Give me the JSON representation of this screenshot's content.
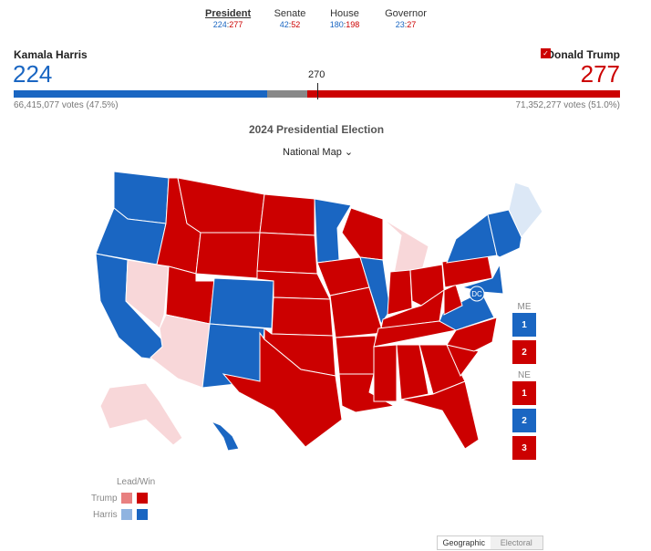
{
  "tabs": [
    {
      "label": "President",
      "dem": "224",
      "rep": "277",
      "active": true
    },
    {
      "label": "Senate",
      "dem": "42",
      "rep": "52"
    },
    {
      "label": "House",
      "dem": "180",
      "rep": "198"
    },
    {
      "label": "Governor",
      "dem": "23",
      "rep": "27"
    }
  ],
  "harris": {
    "name": "Kamala Harris",
    "electoral": "224",
    "votes": "66,415,077 votes (47.5%)"
  },
  "trump": {
    "name": "Donald Trump",
    "electoral": "277",
    "votes": "71,352,277 votes (51.0%)",
    "winner_check": "✓"
  },
  "threshold": "270",
  "title": "2024 Presidential Election",
  "view_select": "National Map",
  "colors": {
    "rep_win": "#cc0000",
    "rep_lead": "#f8d7d9",
    "dem_win": "#1a66c2",
    "dem_lead": "#dce8f6",
    "undecided": "#888888"
  },
  "states": {
    "WA": "D",
    "OR": "D",
    "CA": "D",
    "NV": "RL",
    "ID": "R",
    "MT": "R",
    "WY": "R",
    "UT": "R",
    "AZ": "RL",
    "CO": "D",
    "NM": "D",
    "ND": "R",
    "SD": "R",
    "NE": "R",
    "KS": "R",
    "OK": "R",
    "TX": "R",
    "MN": "D",
    "IA": "R",
    "MO": "R",
    "AR": "R",
    "LA": "R",
    "WI": "R",
    "IL": "D",
    "MI": "RL",
    "IN": "R",
    "OH": "R",
    "KY": "R",
    "TN": "R",
    "MS": "R",
    "AL": "R",
    "GA": "R",
    "FL": "R",
    "SC": "R",
    "NC": "R",
    "VA": "D",
    "WV": "R",
    "PA": "R",
    "NY": "D",
    "NE_REG": "D",
    "ME": "DL",
    "AK": "RL",
    "HI": "D",
    "MDNJ": "D"
  },
  "dc_label": "DC",
  "districts": {
    "me_label": "ME",
    "me": [
      {
        "n": "1",
        "p": "D"
      },
      {
        "n": "2",
        "p": "R"
      }
    ],
    "ne_label": "NE",
    "ne": [
      {
        "n": "1",
        "p": "R"
      },
      {
        "n": "2",
        "p": "D"
      },
      {
        "n": "3",
        "p": "R"
      }
    ]
  },
  "legend": {
    "title": "Lead/Win",
    "trump": "Trump",
    "harris": "Harris",
    "trump_lead": "#e88080",
    "trump_win": "#cc0000",
    "harris_lead": "#8fb3e0",
    "harris_win": "#1a66c2"
  },
  "toggle": {
    "geo": "Geographic",
    "electoral": "Electoral"
  }
}
